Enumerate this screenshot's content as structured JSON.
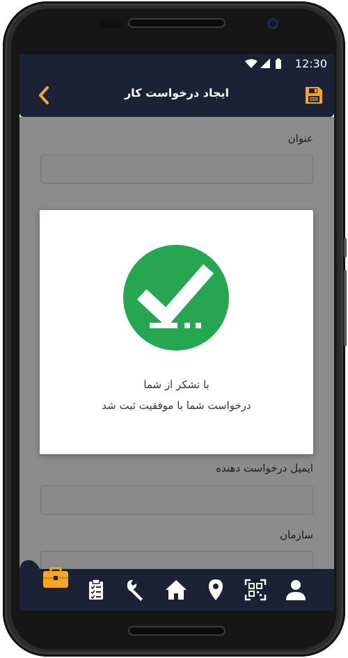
{
  "status_bar": {
    "time": "12:30",
    "icons": [
      "wifi-icon",
      "signal-icon",
      "battery-icon"
    ]
  },
  "app_bar": {
    "title": "ایجاد درخواست کار",
    "back_icon": "chevron-left-icon",
    "save_icon": "save-icon"
  },
  "form": {
    "fields": [
      {
        "label": "عنوان",
        "value": ""
      },
      {
        "label": "ایمیل درخواست دهنده",
        "value": ""
      },
      {
        "label": "سازمان",
        "value": ""
      }
    ]
  },
  "dialog": {
    "icon": "success-check-icon",
    "line1": "با تشکر از شما",
    "line2": "درخواست شما با موفقیت ثبت شد"
  },
  "bottom_nav": {
    "items": [
      {
        "name": "profile",
        "icon": "user-icon"
      },
      {
        "name": "qr",
        "icon": "qr-scan-icon"
      },
      {
        "name": "location",
        "icon": "location-pin-icon"
      },
      {
        "name": "home",
        "icon": "home-icon"
      },
      {
        "name": "tools",
        "icon": "wrench-icon"
      },
      {
        "name": "tasks",
        "icon": "clipboard-icon"
      }
    ],
    "active": "work-request",
    "fab_icon": "briefcase-icon"
  },
  "colors": {
    "primary_dark": "#1c2235",
    "accent": "#f5a623",
    "success": "#27a651"
  }
}
